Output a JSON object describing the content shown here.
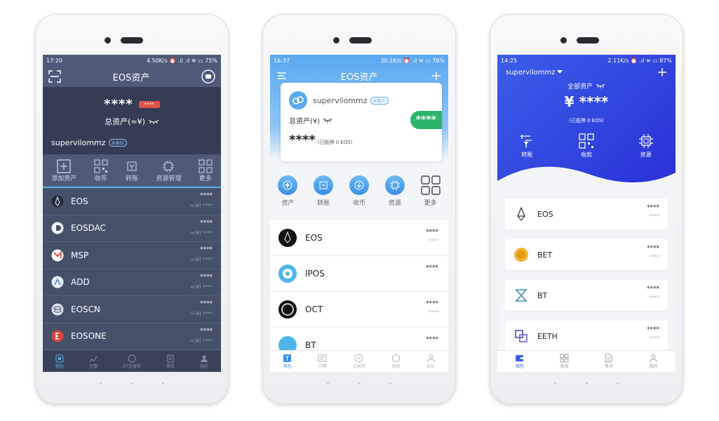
{
  "phone1": {
    "status": {
      "time": "17:20",
      "right": "4.50K/s ⏰ .ıl .ıl ≋ ▭ 75%"
    },
    "title": "EOS资产",
    "masked": "****",
    "badge": "****",
    "total_label": "总资产(≈¥)",
    "username": "supervilommz",
    "backup_badge": "未备份",
    "tools": [
      "添加资产",
      "收币",
      "转账",
      "资源管理",
      "更多"
    ],
    "assets": [
      {
        "name": "EOS",
        "value": "****",
        "sub": "≈(¥) ****"
      },
      {
        "name": "EOSDAC",
        "value": "****",
        "sub": "≈(¥) ****"
      },
      {
        "name": "MSP",
        "value": "****",
        "sub": "≈(¥) ****"
      },
      {
        "name": "ADD",
        "value": "****",
        "sub": "≈(¥) ****"
      },
      {
        "name": "EOSCN",
        "value": "****",
        "sub": "≈(¥) ****"
      },
      {
        "name": "EOSONE",
        "value": "****",
        "sub": "≈(¥) ****"
      }
    ],
    "nav": [
      "钱包",
      "行情",
      "ET交易所",
      "排名",
      "我的"
    ],
    "colors": {
      "bg": "#455069",
      "hero": "#353d55",
      "accent": "#5ab0e6",
      "badge": "#e0524a"
    }
  },
  "phone2": {
    "status": {
      "time": "16:37",
      "right": "30.1K/s ⏰ .ıl ≋ ▭ 76%"
    },
    "title": "EOS资产",
    "username": "supervilommz",
    "backup_badge": "未备份",
    "total_label": "总资产(¥)",
    "green_masked": "****",
    "masked": "****",
    "staked": "(已抵押 0 EOS)",
    "tools": [
      "资产",
      "转账",
      "收币",
      "资源",
      "更多"
    ],
    "assets": [
      {
        "name": "EOS",
        "value": "****",
        "sub": "****"
      },
      {
        "name": "IPOS",
        "value": "****",
        "sub": ""
      },
      {
        "name": "OCT",
        "value": "****",
        "sub": "****"
      },
      {
        "name": "BT",
        "value": "****",
        "sub": ""
      }
    ],
    "nav": [
      "钱包",
      "行情",
      "交易所",
      "发现",
      "我的"
    ],
    "colors": {
      "header": "#5aa8f0",
      "green": "#2cb56a",
      "circle": "#3a8fe6"
    }
  },
  "phone3": {
    "status": {
      "time": "14:25",
      "right": "2.11K/s ⏰ .ıl ≋ ▭ 87%"
    },
    "username": "supervilommz",
    "total_label": "全部资产",
    "masked": "¥ ****",
    "staked": "(已抵押 0 EOS)",
    "tools": [
      "转账",
      "收款",
      "资源"
    ],
    "assets": [
      {
        "name": "EOS",
        "value": "****",
        "sub": "****"
      },
      {
        "name": "BET",
        "value": "****",
        "sub": "****"
      },
      {
        "name": "BT",
        "value": "****",
        "sub": "****"
      },
      {
        "name": "EETH",
        "value": "****",
        "sub": "****"
      }
    ],
    "nav": [
      "钱包",
      "发现",
      "资讯",
      "我的"
    ],
    "colors": {
      "header": "#3b5ee8",
      "active": "#3b5ee8"
    }
  }
}
